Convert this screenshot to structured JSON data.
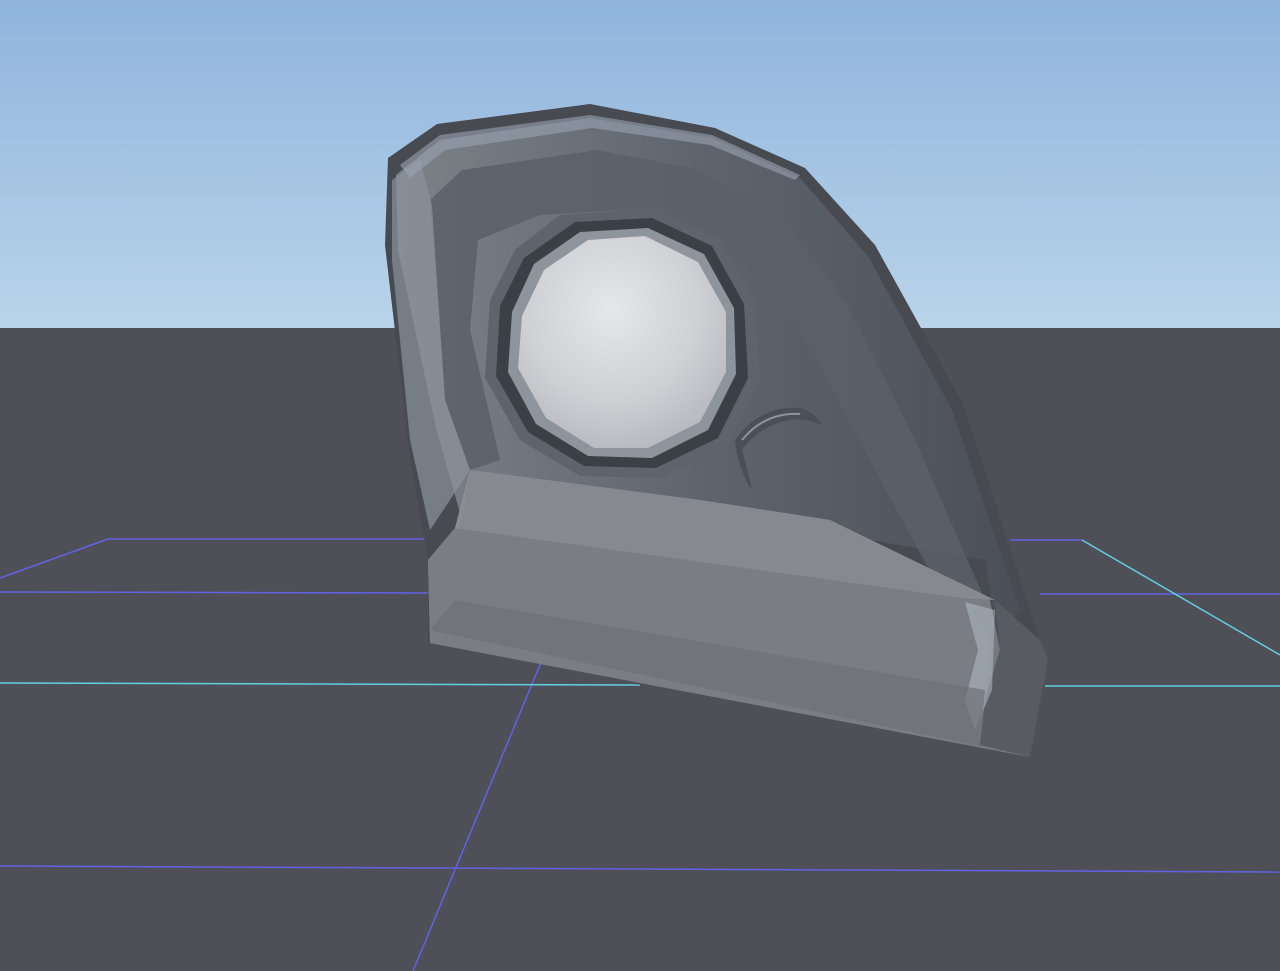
{
  "viewport": {
    "sky_top_color": "#8fb5dd",
    "sky_horizon_color": "#b8d3ea",
    "ground_color": "#4f4f58",
    "grid_line_color": "#6464e6",
    "x_axis_color": "#5fd0e0",
    "model_color": "#8a8d92",
    "model_rim_color": "#3c3f45",
    "eye_lens_color": "#d9dadd"
  }
}
